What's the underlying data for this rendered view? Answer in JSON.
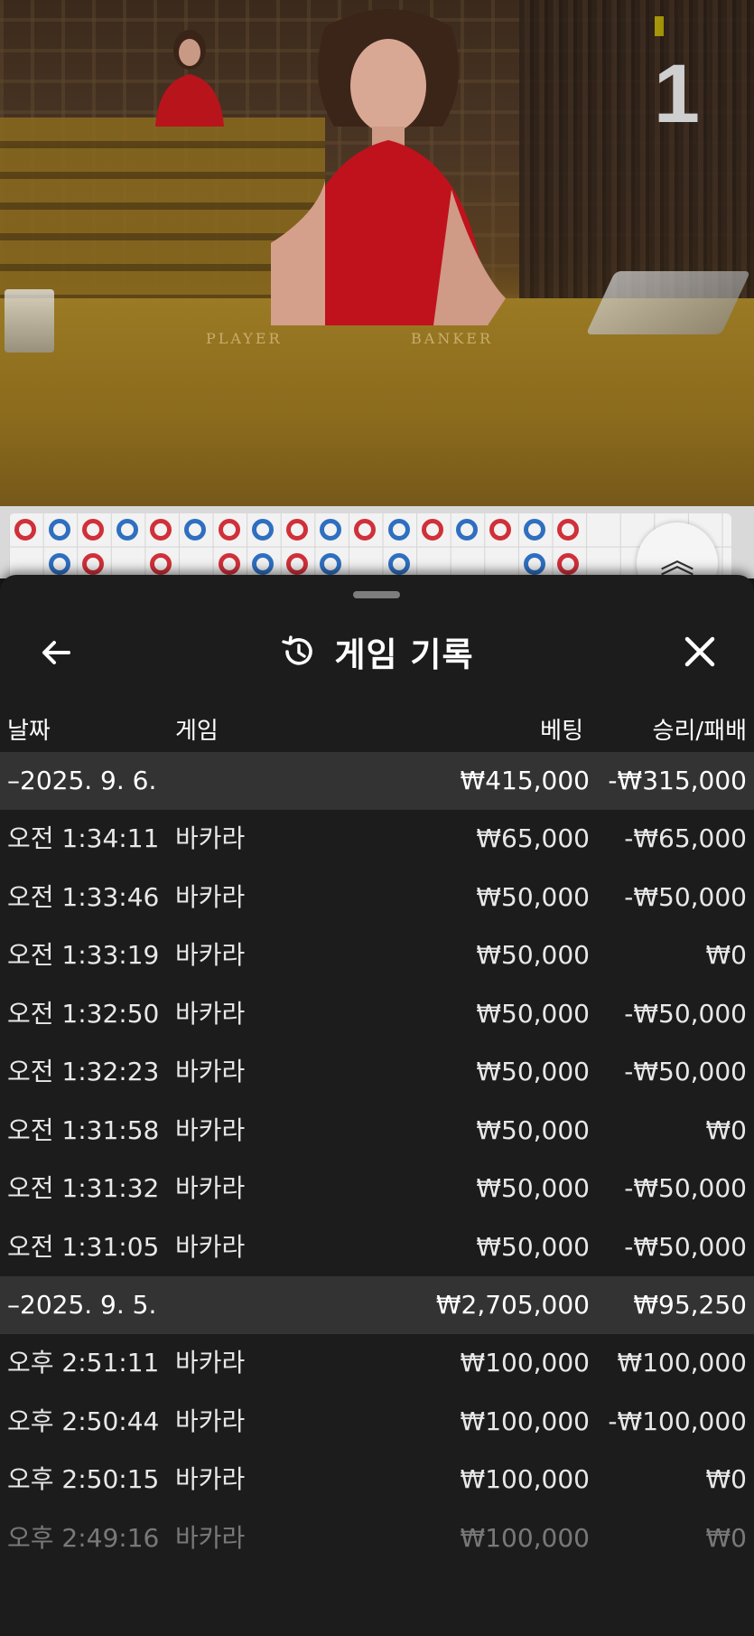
{
  "video": {
    "round_number": "1",
    "table_labels": [
      "PLAYER",
      "BANKER"
    ]
  },
  "history": {
    "title": "게임 기록",
    "columns": {
      "date": "날짜",
      "game": "게임",
      "bet": "베팅",
      "result": "승리/패배"
    },
    "groups": [
      {
        "date": "–2025. 9. 6.",
        "total_bet": "₩415,000",
        "total_result": "-₩315,000",
        "rows": [
          {
            "time": "오전 1:34:11",
            "game": "바카라",
            "bet": "₩65,000",
            "result": "-₩65,000"
          },
          {
            "time": "오전 1:33:46",
            "game": "바카라",
            "bet": "₩50,000",
            "result": "-₩50,000"
          },
          {
            "time": "오전 1:33:19",
            "game": "바카라",
            "bet": "₩50,000",
            "result": "₩0"
          },
          {
            "time": "오전 1:32:50",
            "game": "바카라",
            "bet": "₩50,000",
            "result": "-₩50,000"
          },
          {
            "time": "오전 1:32:23",
            "game": "바카라",
            "bet": "₩50,000",
            "result": "-₩50,000"
          },
          {
            "time": "오전 1:31:58",
            "game": "바카라",
            "bet": "₩50,000",
            "result": "₩0"
          },
          {
            "time": "오전 1:31:32",
            "game": "바카라",
            "bet": "₩50,000",
            "result": "-₩50,000"
          },
          {
            "time": "오전 1:31:05",
            "game": "바카라",
            "bet": "₩50,000",
            "result": "-₩50,000"
          }
        ]
      },
      {
        "date": "–2025. 9. 5.",
        "total_bet": "₩2,705,000",
        "total_result": "₩95,250",
        "rows": [
          {
            "time": "오후 2:51:11",
            "game": "바카라",
            "bet": "₩100,000",
            "result": "₩100,000"
          },
          {
            "time": "오후 2:50:44",
            "game": "바카라",
            "bet": "₩100,000",
            "result": "-₩100,000"
          },
          {
            "time": "오후 2:50:15",
            "game": "바카라",
            "bet": "₩100,000",
            "result": "₩0"
          },
          {
            "time": "오후 2:49:16",
            "game": "바카라",
            "bet": "₩100,000",
            "result": "₩0"
          }
        ]
      }
    ]
  },
  "icons": {
    "back": "back-arrow-icon",
    "history": "history-clock-icon",
    "close": "close-icon",
    "road_toggle": "chevron-up-icon"
  },
  "colors": {
    "sheet_bg": "#1c1c1c",
    "group_row_bg": "#333333",
    "banker_red": "#d0303a",
    "player_blue": "#2f6fc0"
  }
}
